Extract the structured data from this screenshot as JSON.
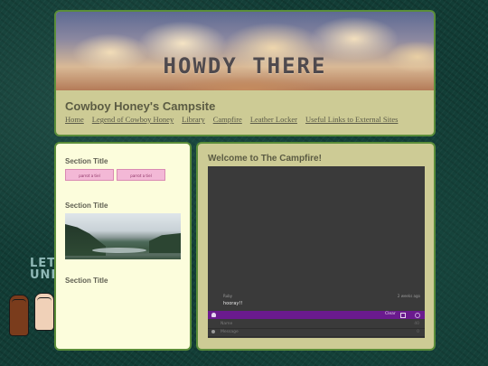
{
  "header": {
    "banner_text": "HOWDY THERE",
    "site_name": "Cowboy Honey's Campsite",
    "nav": [
      "Home",
      "Legend of Cowboy Honey",
      "Library",
      "Campfire",
      "Leather Locker",
      "Useful Links to External Sites"
    ]
  },
  "sidebar": {
    "sections": [
      "Section Title",
      "Section Title",
      "Section Title"
    ],
    "badges": [
      "parrot a tiel",
      "parrot a tiel"
    ]
  },
  "main": {
    "title": "Welcome to The Campfire!",
    "chat": {
      "message": {
        "user": "Ruby",
        "time": "2 weeks ago",
        "text": "hooray!!"
      },
      "clear_label": "Clear",
      "name_placeholder": "Name",
      "message_placeholder": "Message",
      "name_count": "40",
      "message_count": "0"
    }
  },
  "decoration": {
    "line1": "LET",
    "line2": "UNI"
  },
  "colors": {
    "background": "#123d36",
    "panel": "#cdcb95",
    "sidebar": "#fcfddc",
    "border": "#5a8d39",
    "chat_bar": "#6a1a8e"
  }
}
